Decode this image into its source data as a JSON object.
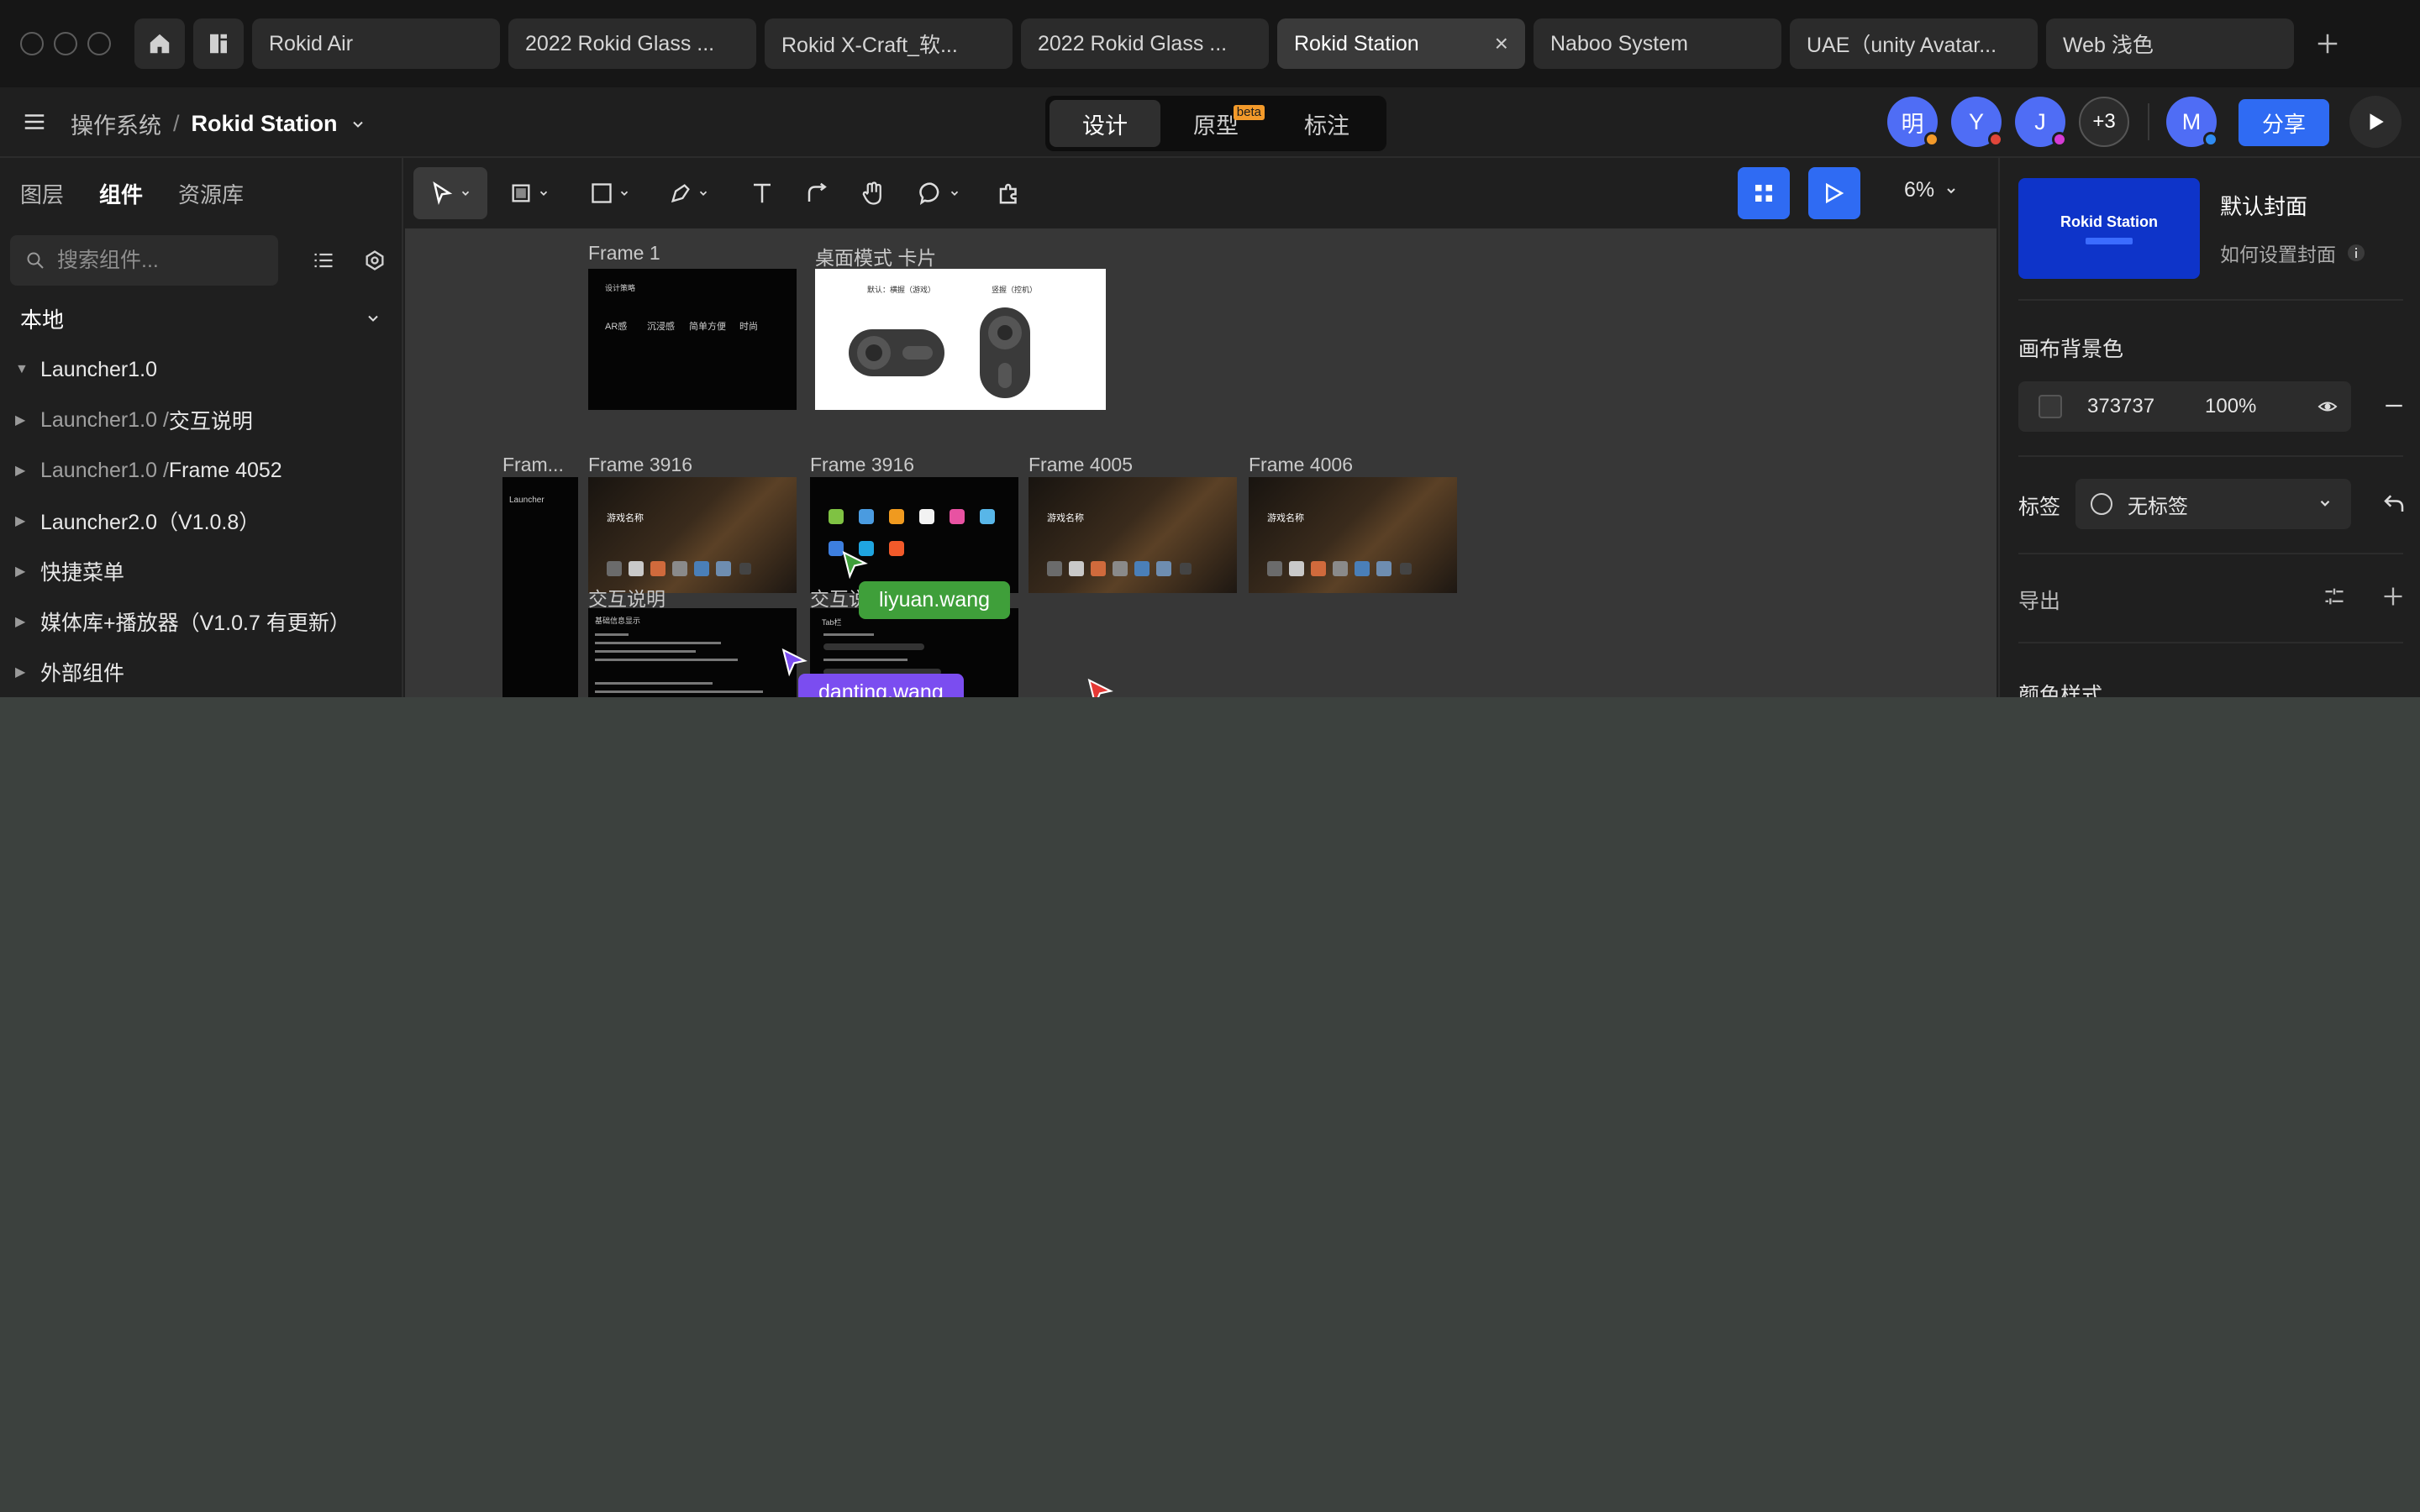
{
  "tabs": {
    "items": [
      {
        "label": "Rokid Air"
      },
      {
        "label": "2022 Rokid Glass ..."
      },
      {
        "label": "Rokid X-Craft_软..."
      },
      {
        "label": "2022 Rokid Glass ..."
      },
      {
        "label": "Rokid Station",
        "active": true
      },
      {
        "label": "Naboo System"
      },
      {
        "label": "UAE（unity Avatar..."
      },
      {
        "label": "Web 浅色"
      }
    ],
    "close_glyph": "×",
    "new_tab_glyph": "+"
  },
  "header": {
    "breadcrumb_parent": "操作系统",
    "breadcrumb_sep": "/",
    "breadcrumb_current": "Rokid Station",
    "modes": [
      {
        "label": "设计",
        "active": true
      },
      {
        "label": "原型",
        "badge": "beta"
      },
      {
        "label": "标注"
      }
    ],
    "avatars": [
      {
        "initial": "明",
        "color": "#4f6df5",
        "dot": "#f39a2a"
      },
      {
        "initial": "Y",
        "color": "#4f6df5",
        "dot": "#e0463a"
      },
      {
        "initial": "J",
        "color": "#4f6df5",
        "dot": "#d63bd6"
      },
      {
        "initial": "+3",
        "color": "#2c2c2c",
        "dot": ""
      }
    ],
    "me_avatar": {
      "initial": "M",
      "color": "#4f6df5",
      "dot": "#2f8cf3"
    },
    "share_label": "分享"
  },
  "left_panel": {
    "tabs": [
      {
        "label": "图层"
      },
      {
        "label": "组件",
        "active": true
      },
      {
        "label": "资源库"
      }
    ],
    "search_placeholder": "搜索组件...",
    "section_title": "本地",
    "tree": [
      {
        "prefix": "",
        "label": "Launcher1.0",
        "expanded": true
      },
      {
        "prefix": "Launcher1.0 / ",
        "label": "交互说明"
      },
      {
        "prefix": "Launcher1.0 / ",
        "label": "Frame 4052"
      },
      {
        "prefix": "",
        "label": "Launcher2.0（V1.0.8）"
      },
      {
        "prefix": "",
        "label": "快捷菜单"
      },
      {
        "prefix": "",
        "label": "媒体库+播放器（V1.0.7 有更新）"
      },
      {
        "prefix": "",
        "label": "外部组件"
      }
    ]
  },
  "toolbar": {
    "zoom": "6%"
  },
  "canvas": {
    "frames": {
      "frame1": {
        "label": "Frame 1",
        "title": "设计策略",
        "keywords": [
          "AR感",
          "沉浸感",
          "简单方便",
          "时尚"
        ]
      },
      "desk": {
        "label": "桌面模式 卡片",
        "left_caption": "默认：横握（游戏）",
        "right_caption": "竖握（控机）"
      },
      "launcher": {
        "label": "Fram...",
        "title": "Launcher"
      },
      "f3916a": {
        "label": "Frame 3916",
        "game_title": "游戏名称"
      },
      "f3916b": {
        "label": "Frame 3916"
      },
      "f4005": {
        "label": "Frame 4005",
        "game_title": "游戏名称"
      },
      "f4006": {
        "label": "Frame 4006",
        "game_title": "游戏名称"
      },
      "interact1": {
        "label": "交互说明",
        "title": "基础信息显示"
      },
      "interact2": {
        "label": "交互说",
        "title": "Tab栏"
      }
    },
    "cursors": [
      {
        "name": "liyuan.wang",
        "color": "#3f9f3a"
      },
      {
        "name": "danting.wang",
        "color": "#7b4df0"
      }
    ]
  },
  "right_panel": {
    "cover_thumb_title": "Rokid Station",
    "cover_title": "默认封面",
    "cover_help": "如何设置封面",
    "canvas_bg_label": "画布背景色",
    "canvas_bg_hex": "373737",
    "canvas_bg_opacity": "100%",
    "tag_label": "标签",
    "tag_value": "无标签",
    "export_label": "导出",
    "color_style_label": "颜色样式"
  }
}
